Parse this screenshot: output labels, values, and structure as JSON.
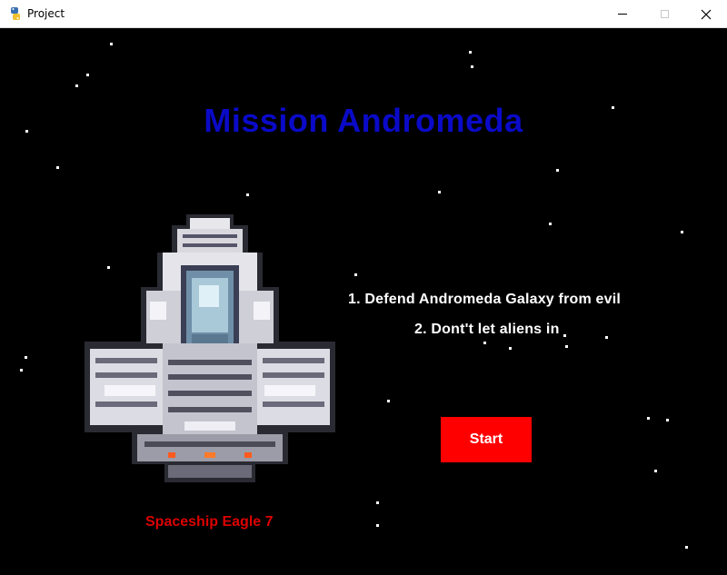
{
  "window": {
    "title": "Project",
    "app_icon": "python-snake-icon",
    "controls": [
      "minimize-icon",
      "maximize-icon",
      "close-icon"
    ]
  },
  "game": {
    "background_color": "#000000",
    "title": "Mission Andromeda",
    "title_color": "#0a0ac8",
    "rules": [
      "1. Defend Andromeda Galaxy from evil",
      "2. Dont't let aliens in"
    ],
    "start_button": {
      "label": "Start",
      "color": "#ff0000"
    },
    "ship_name": "Spaceship Eagle 7",
    "ship_name_color": "#dc0000",
    "ship_image": "pixel-art-spaceship"
  }
}
